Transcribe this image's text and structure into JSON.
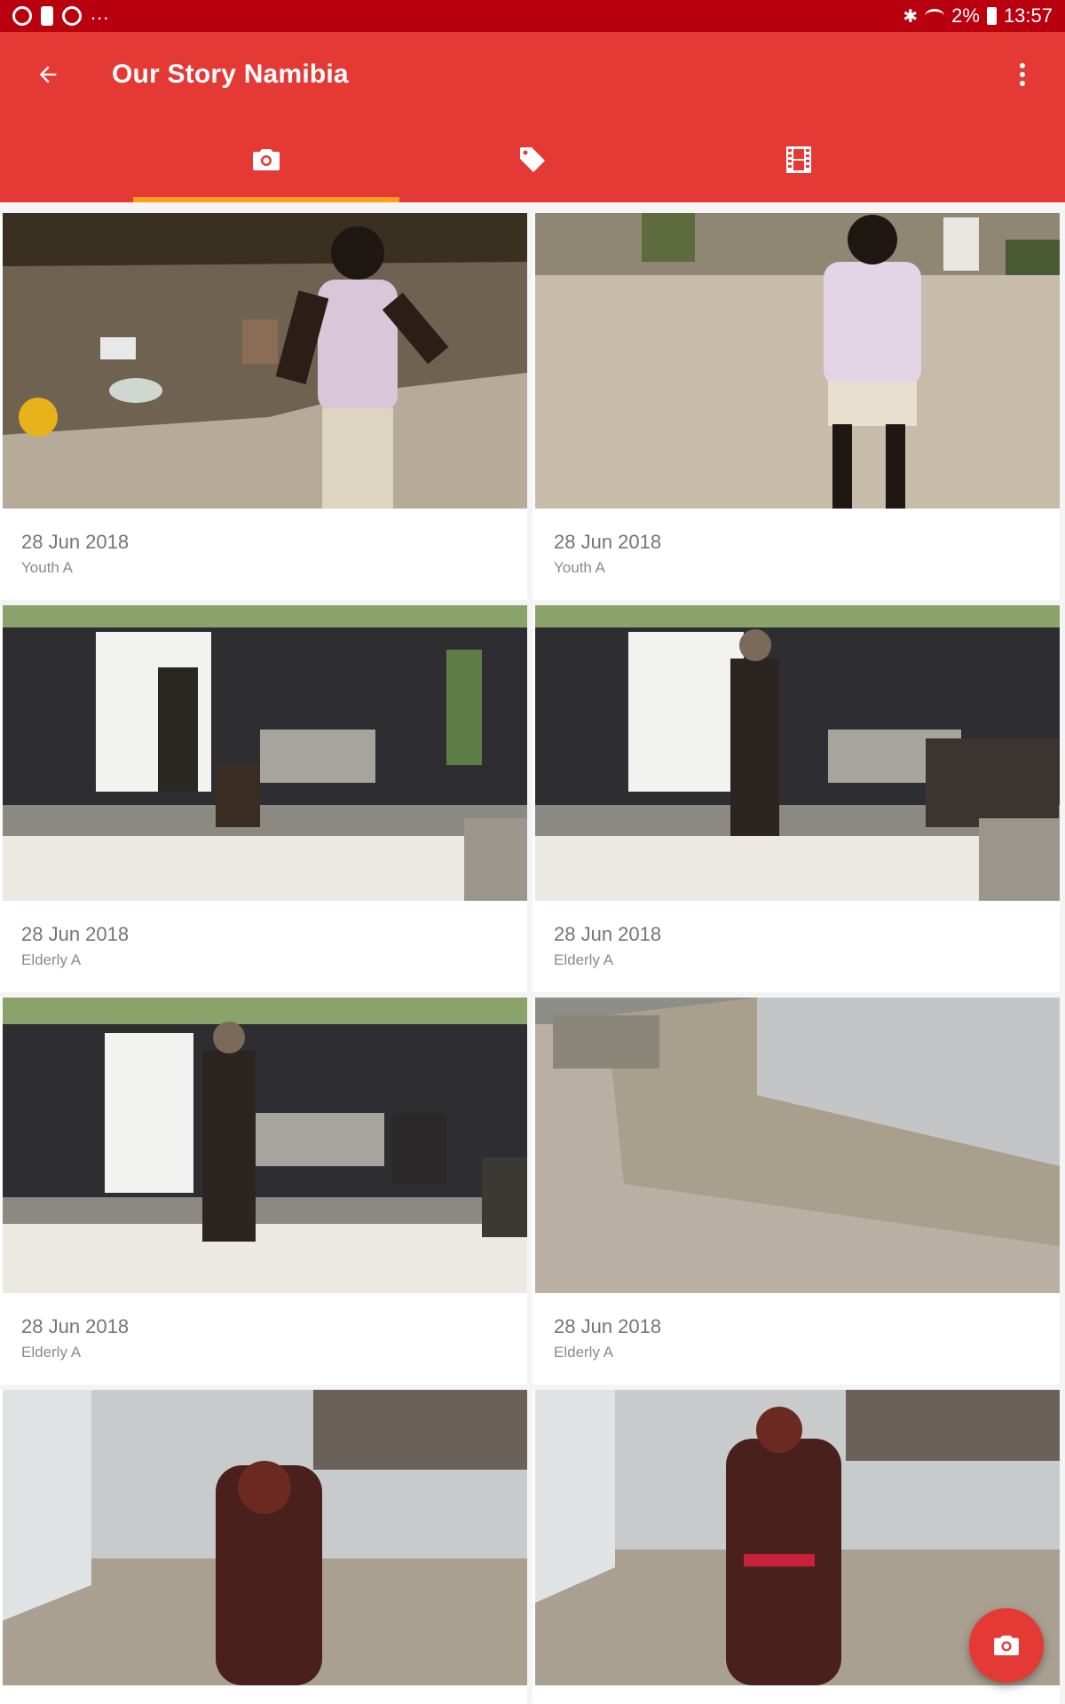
{
  "status_bar": {
    "battery": "2%",
    "time": "13:57",
    "overflow": "..."
  },
  "toolbar": {
    "title": "Our Story Namibia"
  },
  "tabs": [
    {
      "icon": "camera-icon",
      "active": true
    },
    {
      "icon": "tag-icon",
      "active": false
    },
    {
      "icon": "film-icon",
      "active": false
    }
  ],
  "photos": [
    {
      "date": "28 Jun 2018",
      "label": "Youth A"
    },
    {
      "date": "28 Jun 2018",
      "label": "Youth A"
    },
    {
      "date": "28 Jun 2018",
      "label": "Elderly A"
    },
    {
      "date": "28 Jun 2018",
      "label": "Elderly A"
    },
    {
      "date": "28 Jun 2018",
      "label": "Elderly A"
    },
    {
      "date": "28 Jun 2018",
      "label": "Elderly A"
    },
    {
      "date": "",
      "label": ""
    },
    {
      "date": "",
      "label": ""
    }
  ],
  "colors": {
    "app_bar": "#e53935",
    "status_bar": "#b8000f",
    "tab_indicator": "#ff9e1b"
  }
}
